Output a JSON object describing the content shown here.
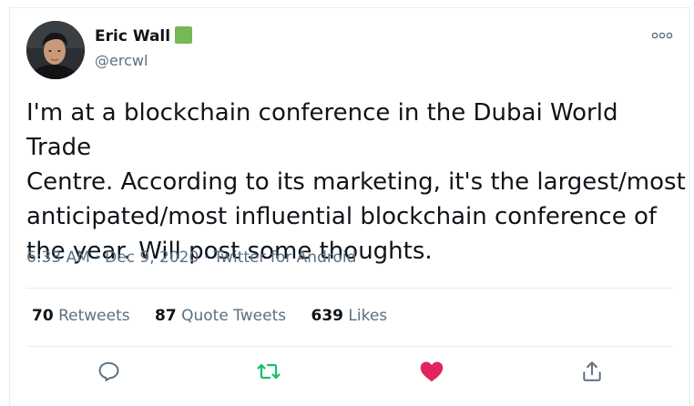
{
  "tweet": {
    "author": {
      "name": "Eric Wall",
      "handle": "@ercwl",
      "badge_color": "#76b756"
    },
    "more_icon": "more-options-icon",
    "text": "I'm at a blockchain conference in the Dubai World Trade\nCentre. According to its marketing, it's the largest/most\nanticipated/most influential blockchain conference of\nthe year. Will post some thoughts.",
    "meta": {
      "time": "6:33 AM",
      "separator": "·",
      "date": "Dec 9, 2020",
      "source": "Twitter for Android"
    },
    "stats": {
      "retweets_count": "70",
      "retweets_label": "Retweets",
      "quote_count": "87",
      "quote_label": "Quote Tweets",
      "likes_count": "639",
      "likes_label": "Likes"
    },
    "actions": {
      "reply_icon": "reply-icon",
      "retweet_icon": "retweet-icon",
      "like_icon": "heart-icon",
      "share_icon": "share-icon",
      "retweet_color": "#17bf63",
      "like_color": "#e0245e",
      "neutral_color": "#5b7083"
    }
  }
}
